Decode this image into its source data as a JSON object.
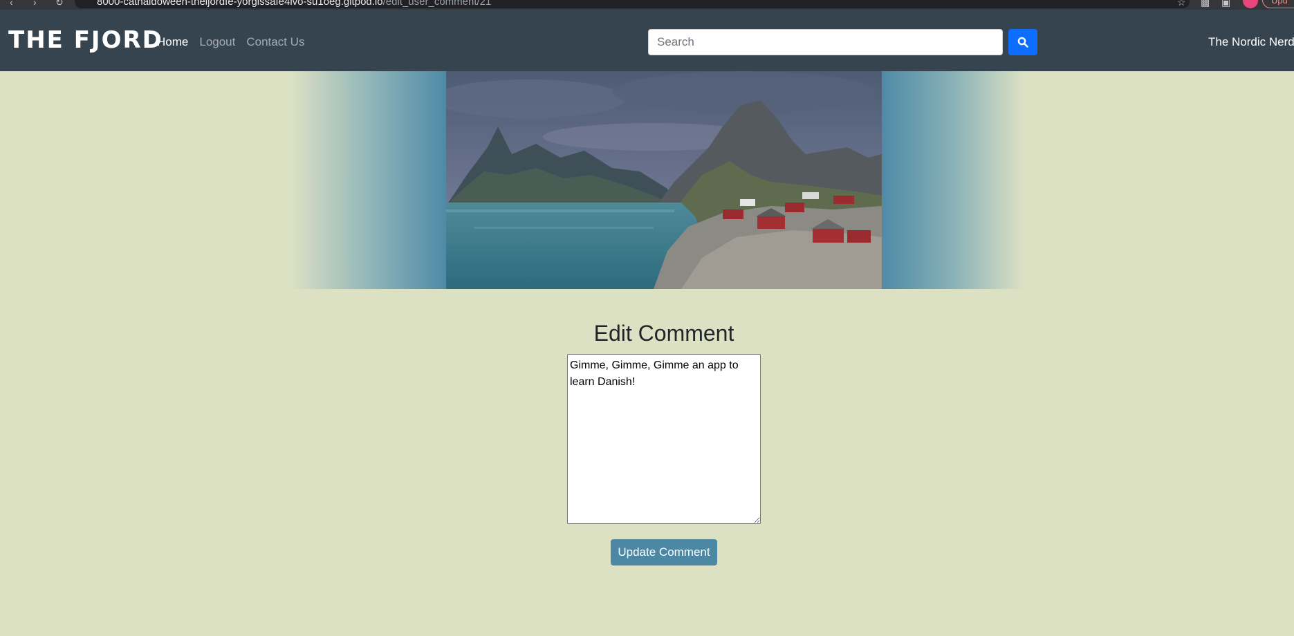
{
  "browser": {
    "url_host": "8000-cathaldoween-theijordfe-yorgissafe4ivo-su1oeg.gitpod.io",
    "url_path": "/edit_user_comment/21",
    "update_label": "Upd"
  },
  "navbar": {
    "brand": "THE FJORD",
    "links": [
      {
        "label": "Home"
      },
      {
        "label": "Logout"
      },
      {
        "label": "Contact Us"
      }
    ],
    "search_placeholder": "Search",
    "site_name": "The Nordic Nerd"
  },
  "hero": {
    "image_alt": "Fjord landscape with red cabins and mountains"
  },
  "form": {
    "title": "Edit Comment",
    "comment_value": "Gimme, Gimme, Gimme an app to learn Danish!",
    "submit_label": "Update Comment"
  },
  "colors": {
    "navbar_bg": "#36444f",
    "page_bg": "#dce1c4",
    "search_button": "#0d6efd",
    "submit_button": "#4c87a4"
  }
}
